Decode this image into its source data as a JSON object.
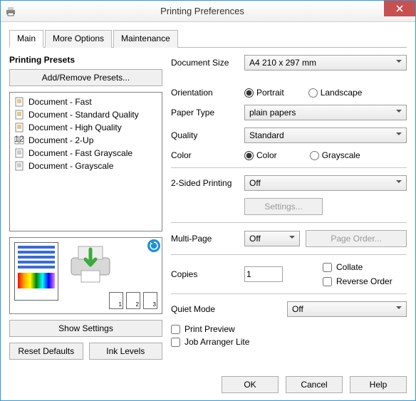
{
  "title": "Printing Preferences",
  "tabs": [
    "Main",
    "More Options",
    "Maintenance"
  ],
  "left": {
    "presets_title": "Printing Presets",
    "add_remove": "Add/Remove Presets...",
    "presets": [
      "Document - Fast",
      "Document - Standard Quality",
      "Document - High Quality",
      "Document - 2-Up",
      "Document - Fast Grayscale",
      "Document - Grayscale"
    ],
    "show_settings": "Show Settings",
    "reset_defaults": "Reset Defaults",
    "ink_levels": "Ink Levels"
  },
  "right": {
    "document_size": {
      "label": "Document Size",
      "value": "A4 210 x 297 mm"
    },
    "orientation": {
      "label": "Orientation",
      "options": [
        "Portrait",
        "Landscape"
      ],
      "value": "Portrait"
    },
    "paper_type": {
      "label": "Paper Type",
      "value": "plain papers"
    },
    "quality": {
      "label": "Quality",
      "value": "Standard"
    },
    "color": {
      "label": "Color",
      "options": [
        "Color",
        "Grayscale"
      ],
      "value": "Color"
    },
    "two_sided": {
      "label": "2-Sided Printing",
      "value": "Off",
      "settings": "Settings..."
    },
    "multi_page": {
      "label": "Multi-Page",
      "value": "Off",
      "page_order": "Page Order..."
    },
    "copies": {
      "label": "Copies",
      "value": "1",
      "collate": "Collate",
      "reverse": "Reverse Order"
    },
    "quiet_mode": {
      "label": "Quiet Mode",
      "value": "Off"
    },
    "print_preview": "Print Preview",
    "job_arranger": "Job Arranger Lite"
  },
  "footer": {
    "ok": "OK",
    "cancel": "Cancel",
    "help": "Help"
  }
}
